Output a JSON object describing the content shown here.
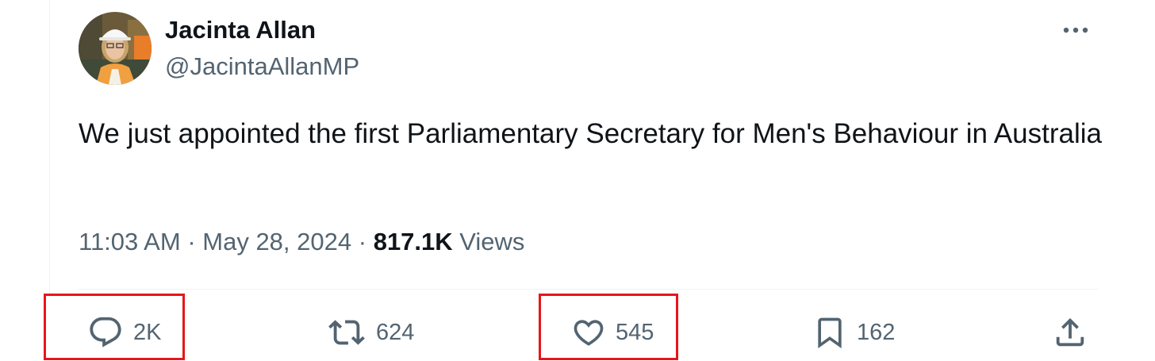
{
  "tweet": {
    "author_name": "Jacinta Allan",
    "author_handle": "@JacintaAllanMP",
    "text": "We just appointed the first Parliamentary Secretary for Men's Behaviour in Australia",
    "time": "11:03 AM",
    "separator": "·",
    "date": "May 28, 2024",
    "views_count": "817.1K",
    "views_label": "Views"
  },
  "actions": {
    "reply_count": "2K",
    "retweet_count": "624",
    "like_count": "545",
    "bookmark_count": "162"
  },
  "icons": {
    "more": "more-icon",
    "reply": "reply-icon",
    "retweet": "retweet-icon",
    "like": "heart-icon",
    "bookmark": "bookmark-icon",
    "share": "share-icon"
  },
  "colors": {
    "text": "#0f1419",
    "secondary": "#536471",
    "highlight_box": "#e8151b",
    "divider": "#eff3f4"
  }
}
